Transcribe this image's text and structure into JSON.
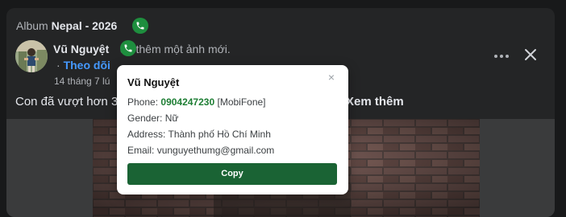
{
  "header": {
    "album_prefix": "Album",
    "album_name": "Nepal - 2026"
  },
  "post": {
    "author_name": "Vũ Nguyệt",
    "action_text": "đã thêm một ảnh mới.",
    "follow_label": "Theo dõi",
    "timestamp": "14 tháng 7 lú",
    "caption": "Con đã vượt hơn 3.",
    "see_more_label": "Xem thêm"
  },
  "popup": {
    "name": "Vũ Nguyệt",
    "close_label": "×",
    "phone_label": "Phone:",
    "phone_number": "0904247230",
    "carrier": "[MobiFone]",
    "gender_label": "Gender:",
    "gender": "Nữ",
    "address_label": "Address:",
    "address": "Thành phố Hồ Chí Minh",
    "email_label": "Email:",
    "email": "vunguyethumg@gmail.com",
    "copy_label": "Copy"
  },
  "icons": {
    "phone": "phone-icon",
    "more": "more-options-icon",
    "close": "close-icon"
  },
  "colors": {
    "background": "#18191a",
    "panel": "#242526",
    "link_blue": "#4599ff",
    "phone_badge_green": "#1e8e3e",
    "copy_button_green": "#1a6334",
    "phone_number_green": "#1e7e34"
  }
}
